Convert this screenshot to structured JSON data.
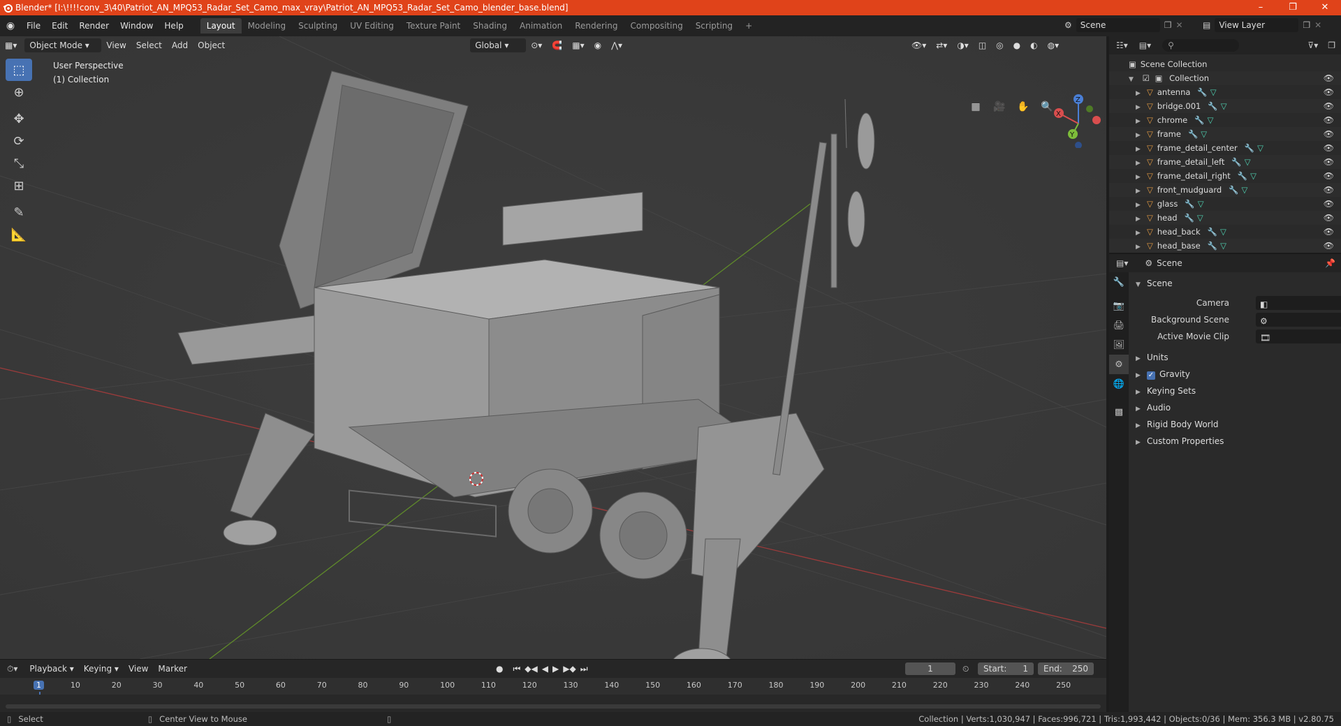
{
  "window": {
    "title": "Blender* [I:\\!!!!conv_3\\40\\Patriot_AN_MPQ53_Radar_Set_Camo_max_vray\\Patriot_AN_MPQ53_Radar_Set_Camo_blender_base.blend]",
    "controls": [
      "–",
      "❐",
      "✕"
    ]
  },
  "menu": [
    "File",
    "Edit",
    "Render",
    "Window",
    "Help"
  ],
  "workspaces": [
    "Layout",
    "Modeling",
    "Sculpting",
    "UV Editing",
    "Texture Paint",
    "Shading",
    "Animation",
    "Rendering",
    "Compositing",
    "Scripting"
  ],
  "active_workspace": "Layout",
  "scene_selector": {
    "label": "Scene"
  },
  "view_layer": {
    "label": "View Layer"
  },
  "viewport": {
    "mode": "Object Mode",
    "menus": [
      "View",
      "Select",
      "Add",
      "Object"
    ],
    "orientation": "Global",
    "overlay_text": [
      "User Perspective",
      "(1) Collection"
    ]
  },
  "outliner": {
    "root": "Scene Collection",
    "collection": "Collection",
    "items": [
      "antenna",
      "bridge.001",
      "chrome",
      "frame",
      "frame_detail_center",
      "frame_detail_left",
      "frame_detail_right",
      "front_mudguard",
      "glass",
      "head",
      "head_back",
      "head_base"
    ]
  },
  "properties": {
    "header": "Scene",
    "panel": "Scene",
    "fields": [
      {
        "label": "Camera"
      },
      {
        "label": "Background Scene"
      },
      {
        "label": "Active Movie Clip"
      }
    ],
    "subpanels": [
      {
        "label": "Units",
        "checkbox": false
      },
      {
        "label": "Gravity",
        "checkbox": true
      },
      {
        "label": "Keying Sets",
        "checkbox": false
      },
      {
        "label": "Audio",
        "checkbox": false
      },
      {
        "label": "Rigid Body World",
        "checkbox": false
      },
      {
        "label": "Custom Properties",
        "checkbox": false
      }
    ]
  },
  "timeline": {
    "menus": [
      "Playback",
      "Keying",
      "View",
      "Marker"
    ],
    "current_frame": "1",
    "start_label": "Start:",
    "start": "1",
    "end_label": "End:",
    "end": "250",
    "ticks": [
      "1",
      "10",
      "20",
      "30",
      "40",
      "50",
      "60",
      "70",
      "80",
      "90",
      "100",
      "110",
      "120",
      "130",
      "140",
      "150",
      "160",
      "170",
      "180",
      "190",
      "200",
      "210",
      "220",
      "230",
      "240",
      "250"
    ]
  },
  "statusbar": {
    "left": "Select",
    "middle": "Center View to Mouse",
    "right": "Collection | Verts:1,030,947 | Faces:996,721 | Tris:1,993,442 | Objects:0/36 | Mem: 356.3 MB | v2.80.75"
  },
  "colors": {
    "titlebar": "#e0431a",
    "accent": "#4772b3",
    "x_axis": "#d94e4e",
    "y_axis": "#7dbd3a",
    "z_axis": "#4a7fd6"
  }
}
